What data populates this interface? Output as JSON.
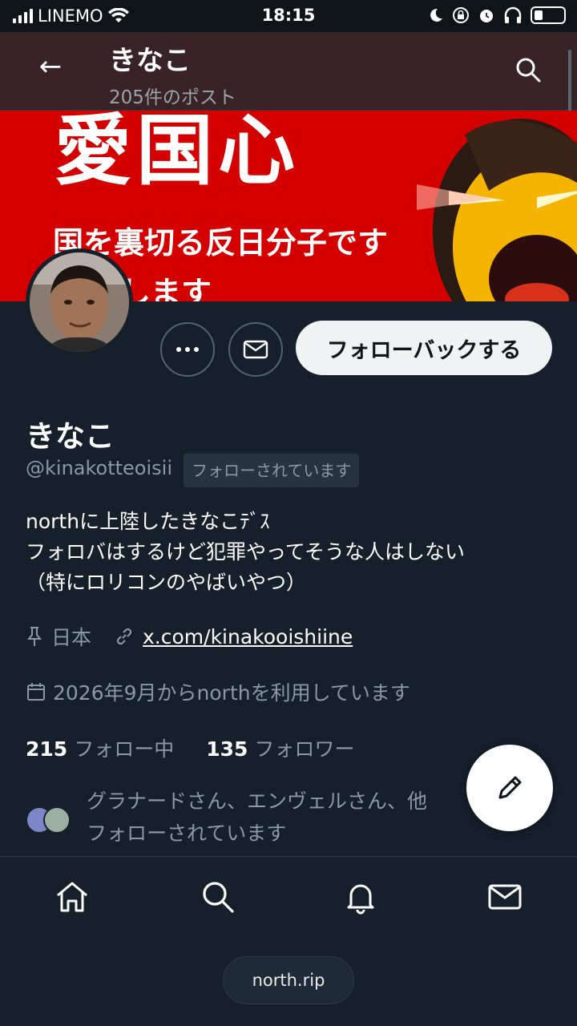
{
  "status_bar": {
    "carrier": "LINEMO",
    "time": "18:15"
  },
  "header": {
    "title": "きなこ",
    "post_count": "205件のポスト",
    "back_icon": "arrow-left-icon",
    "search_icon": "search-icon"
  },
  "banner": {
    "line1": "愛国心",
    "line2": "国を裏切る反日分子です",
    "line3": "します"
  },
  "profile": {
    "name": "きなこ",
    "handle": "@kinakotteoisii",
    "follows_you_badge": "フォローされています",
    "followback_label": "フォローバックする",
    "bio_lines": [
      "northに上陸したきなこﾃﾞｽ",
      "フォロバはするけど犯罪やってそうな人はしない",
      "（特にロリコンのやばいやつ）"
    ],
    "location": "日本",
    "website": "x.com/kinakooishiine",
    "joined": "2026年9月からnorthを利用しています",
    "following_count": "215",
    "following_label": "フォロー中",
    "followers_count": "135",
    "followers_label": "フォロワー",
    "followed_by_line1": "グラナードさん、エンヴェルさん、他",
    "followed_by_line2": "フォローされています"
  },
  "bottom_nav": {
    "items": [
      "home-icon",
      "search-icon",
      "bell-icon",
      "mail-icon"
    ],
    "url": "north.rip"
  },
  "colors": {
    "background": "#15202b",
    "banner_red": "#d40000",
    "text_secondary": "#8b98a5"
  }
}
